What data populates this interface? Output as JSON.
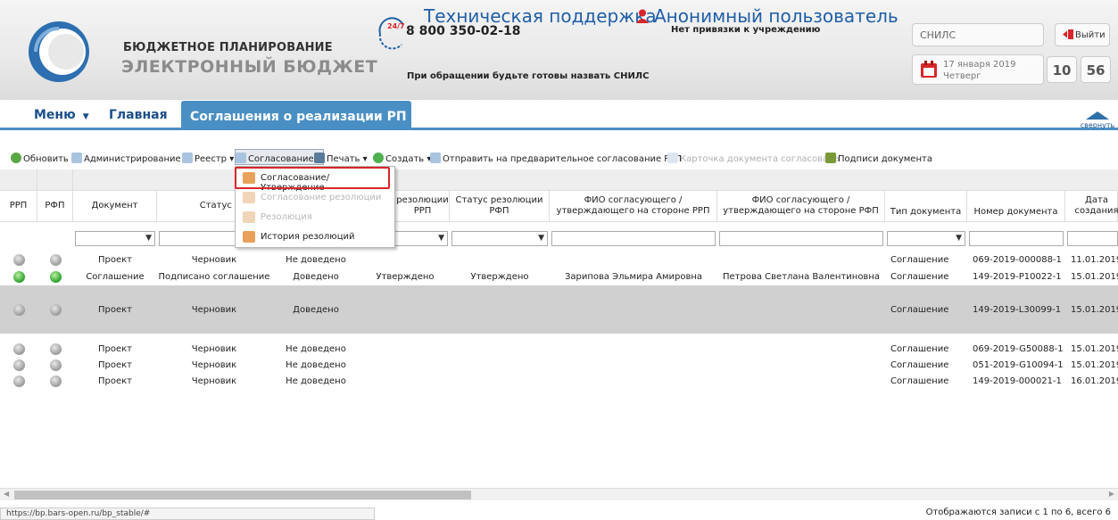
{
  "header": {
    "brand_top": "БЮДЖЕТНОЕ ПЛАНИРОВАНИЕ",
    "brand_bottom": "ЭЛЕКТРОННЫЙ БЮДЖЕТ",
    "phone": "8 800 350-02-18",
    "support_title": "Техническая поддержка",
    "support_badge": "24/7",
    "support_hint": "При обращении будьте готовы назвать СНИЛС",
    "user_name": "Анонимный пользователь",
    "user_org": "Нет привязки к учреждению",
    "snils_placeholder": "СНИЛС",
    "logout_label": "Выйти",
    "date_line1": "17 января 2019",
    "date_line2": "Четверг",
    "clock_hours": "10",
    "clock_minutes": "56"
  },
  "nav": {
    "menu_label": "Меню",
    "home_label": "Главная",
    "active_tab_label": "Соглашения о реализации РП",
    "collapse_label": "свернуть"
  },
  "toolbar": {
    "refresh": "Обновить",
    "admin": "Администрирование",
    "registry": "Реестр",
    "approval": "Согласование",
    "print": "Печать",
    "create": "Создать",
    "send_pre": "Отправить на предварительное согласование РРП",
    "card_approved": "Карточка документа согласована",
    "signatures": "Подписи документа"
  },
  "dropdown": {
    "items": [
      "Согласование/Утверждение",
      "Согласование резолюции",
      "Резолюция",
      "История резолюций"
    ]
  },
  "table": {
    "headers": {
      "rrp": "РРП",
      "rfp": "РФП",
      "doc": "Документ",
      "status_rfp": "Статус РФП",
      "res_rrp": "резолюции РРП",
      "res_status_rfp": "Статус резолюции РФП",
      "fio_rrp": "ФИО согласующего / утверждающего на стороне РРП",
      "fio_rfp": "ФИО согласующего / утверждающего на стороне РФП",
      "doc_type": "Тип документа",
      "doc_number": "Номер документа",
      "created": "Дата создания"
    },
    "rows": [
      {
        "rrp": "grey",
        "rfp": "grey",
        "doc": "Проект",
        "status": "Черновик",
        "comm": "Не доведено",
        "res_rrp": "",
        "res_rfp": "",
        "fio_rrp": "",
        "fio_rfp": "",
        "type": "Соглашение",
        "number": "069-2019-000088-1",
        "date": "11.01.2019"
      },
      {
        "rrp": "green",
        "rfp": "green",
        "doc": "Соглашение",
        "status": "Подписано соглашение",
        "comm": "Доведено",
        "res_rrp": "Утверждено",
        "res_rfp": "Утверждено",
        "fio_rrp": "Зарипова Эльмира Амировна",
        "fio_rfp": "Петрова Светлана Валентиновна",
        "type": "Соглашение",
        "number": "149-2019-P10022-1",
        "date": "15.01.2019"
      },
      {
        "rrp": "grey",
        "rfp": "grey",
        "doc": "Проект",
        "status": "Черновик",
        "comm": "Доведено",
        "res_rrp": "",
        "res_rfp": "",
        "fio_rrp": "",
        "fio_rfp": "",
        "type": "Соглашение",
        "number": "149-2019-L30099-1",
        "date": "15.01.2019"
      },
      {
        "rrp": "grey",
        "rfp": "grey",
        "doc": "Проект",
        "status": "Черновик",
        "comm": "Не доведено",
        "res_rrp": "",
        "res_rfp": "",
        "fio_rrp": "",
        "fio_rfp": "",
        "type": "Соглашение",
        "number": "069-2019-G50088-1",
        "date": "15.01.2019"
      },
      {
        "rrp": "grey",
        "rfp": "grey",
        "doc": "Проект",
        "status": "Черновик",
        "comm": "Не доведено",
        "res_rrp": "",
        "res_rfp": "",
        "fio_rrp": "",
        "fio_rfp": "",
        "type": "Соглашение",
        "number": "051-2019-G10094-1",
        "date": "15.01.2019"
      },
      {
        "rrp": "grey",
        "rfp": "grey",
        "doc": "Проект",
        "status": "Черновик",
        "comm": "Не доведено",
        "res_rrp": "",
        "res_rfp": "",
        "fio_rrp": "",
        "fio_rfp": "",
        "type": "Соглашение",
        "number": "149-2019-000021-1",
        "date": "16.01.2019"
      }
    ]
  },
  "footer": {
    "url": "https://bp.bars-open.ru/bp_stable/#",
    "records_info": "Отображаются записи с 1 по 6, всего 6"
  },
  "colors": {
    "accent_blue": "#4a8fc4",
    "link_blue": "#1f5fa8",
    "highlight_red": "#d8262a",
    "status_green": "#2aa02a",
    "status_grey": "#9a9a9a"
  }
}
